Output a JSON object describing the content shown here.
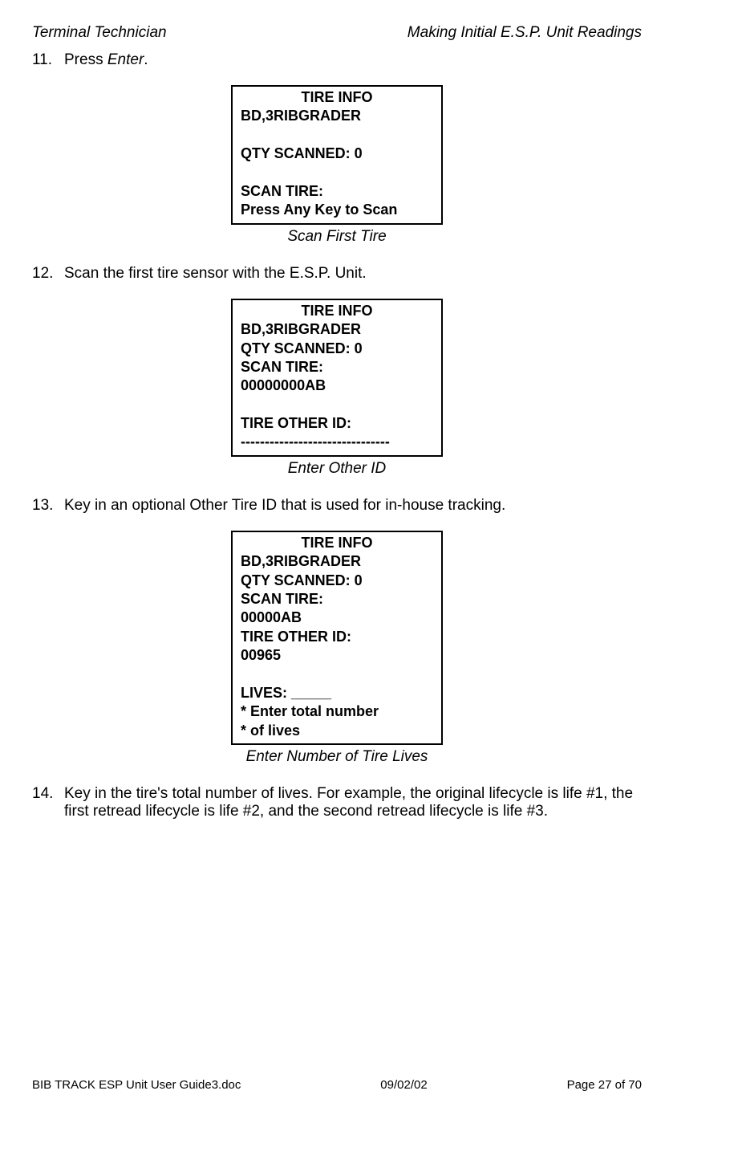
{
  "header": {
    "left": "Terminal Technician",
    "right": "Making Initial E.S.P. Unit Readings"
  },
  "steps": {
    "s11": {
      "num": "11.",
      "text_prefix": "Press ",
      "text_italic": "Enter",
      "text_suffix": "."
    },
    "s12": {
      "num": "12.",
      "text": "Scan the first tire sensor with the E.S.P. Unit."
    },
    "s13": {
      "num": "13.",
      "text": "Key in an optional Other Tire ID that is used for in-house tracking."
    },
    "s14": {
      "num": "14.",
      "text": "Key in the tire's total number of lives.  For example, the original lifecycle is life #1, the first retread lifecycle is life #2, and the second retread lifecycle is life #3."
    }
  },
  "terminals": {
    "t1": {
      "title": "TIRE INFO",
      "l1": "BD,3RIBGRADER",
      "l2": "QTY SCANNED: 0",
      "l3": "SCAN TIRE:",
      "l4": "Press Any Key to Scan",
      "caption": "Scan First Tire"
    },
    "t2": {
      "title": "TIRE INFO",
      "l1": "BD,3RIBGRADER",
      "l2": "QTY SCANNED: 0",
      "l3": "SCAN TIRE:",
      "l4": "00000000AB",
      "l5": "TIRE OTHER ID:",
      "l6": "-------------------------------",
      "caption": "Enter Other ID"
    },
    "t3": {
      "title": "TIRE INFO",
      "l1": "BD,3RIBGRADER",
      "l2": "QTY SCANNED: 0",
      "l3": "SCAN TIRE:",
      "l4": "00000AB",
      "l5": "TIRE OTHER ID:",
      "l6": "00965",
      "l7": "LIVES: _____",
      "l8": "* Enter total number",
      "l9": "* of lives",
      "caption": "Enter Number of Tire Lives"
    }
  },
  "footer": {
    "left": "BIB TRACK  ESP Unit User Guide3.doc",
    "center": "09/02/02",
    "right": "Page 27 of 70"
  }
}
